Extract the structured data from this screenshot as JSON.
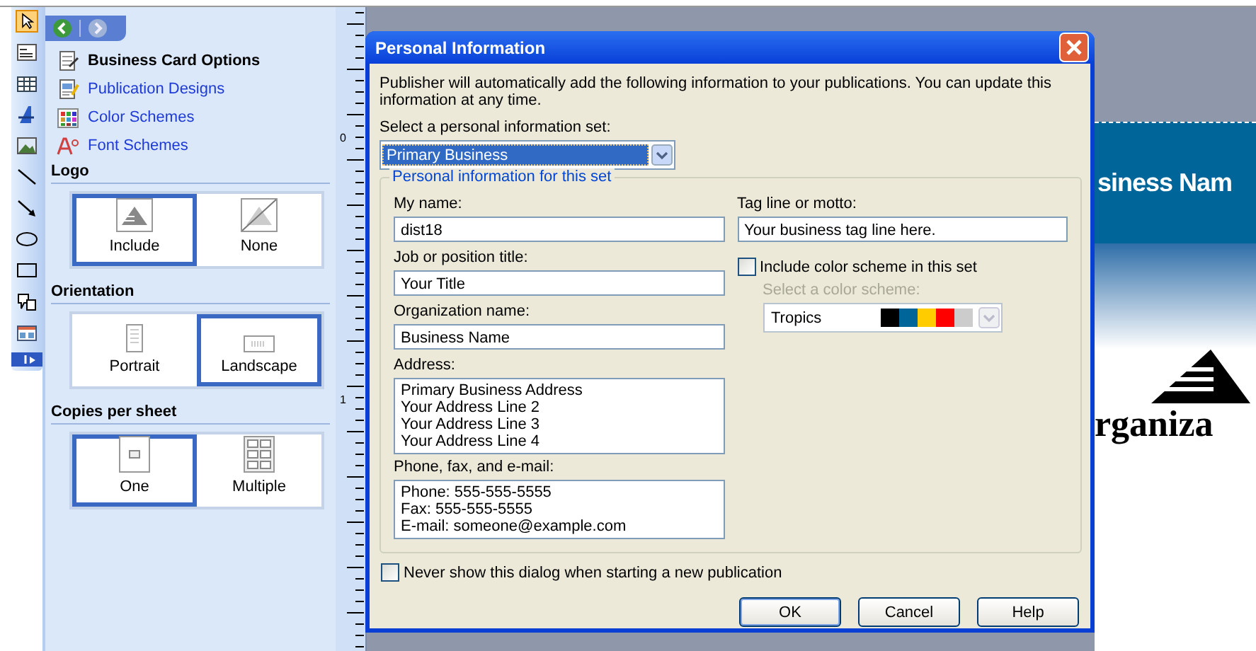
{
  "task_pane": {
    "nav": [
      {
        "label": "Business Card Options",
        "kind": "options",
        "selected": true
      },
      {
        "label": "Publication Designs",
        "kind": "designs",
        "selected": false
      },
      {
        "label": "Color Schemes",
        "kind": "colors",
        "selected": false
      },
      {
        "label": "Font Schemes",
        "kind": "fonts",
        "selected": false
      }
    ],
    "sections": [
      {
        "title": "Logo",
        "options": [
          {
            "label": "Include",
            "kind": "logo",
            "selected": true
          },
          {
            "label": "None",
            "kind": "nologo",
            "selected": false
          }
        ]
      },
      {
        "title": "Orientation",
        "options": [
          {
            "label": "Portrait",
            "kind": "portrait",
            "selected": false
          },
          {
            "label": "Landscape",
            "kind": "landscape",
            "selected": true
          }
        ]
      },
      {
        "title": "Copies per sheet",
        "options": [
          {
            "label": "One",
            "kind": "one",
            "selected": true
          },
          {
            "label": "Multiple",
            "kind": "multiple",
            "selected": false
          }
        ]
      }
    ]
  },
  "ruler": {
    "labels": [
      "0",
      "1"
    ]
  },
  "card": {
    "business_name": "siness Nam",
    "organization": "rganiza"
  },
  "dialog": {
    "title": "Personal Information",
    "intro": "Publisher will automatically add the following information to your publications.  You can update this information at any time.",
    "set_label": "Select a personal information set:",
    "set_value": "Primary Business",
    "group_title": "Personal information for this set",
    "left_fields": [
      {
        "label": "My name:",
        "kind": "line",
        "lines": [
          "dist18"
        ]
      },
      {
        "label": "Job or position title:",
        "kind": "line",
        "lines": [
          "Your Title"
        ]
      },
      {
        "label": "Organization name:",
        "kind": "line",
        "lines": [
          "Business Name"
        ]
      },
      {
        "label": "Address:",
        "kind": "multiline",
        "lines": [
          "Primary Business Address",
          "Your Address Line 2",
          "Your Address Line 3",
          "Your Address Line 4"
        ]
      },
      {
        "label": "Phone, fax, and e-mail:",
        "kind": "multiline",
        "lines": [
          "Phone: 555-555-5555",
          "Fax: 555-555-5555",
          "E-mail: someone@example.com"
        ]
      }
    ],
    "tagline": {
      "label": "Tag line or motto:",
      "value": "Your business tag line here."
    },
    "color_checkbox": {
      "label": "Include color scheme in this set",
      "checked": false
    },
    "scheme": {
      "label": "Select a color scheme:",
      "value": "Tropics",
      "disabled": true,
      "swatches": [
        {
          "color": "#000000"
        },
        {
          "color": "#006699"
        },
        {
          "color": "#ffcc00"
        },
        {
          "color": "#ff0000"
        },
        {
          "color": "#cccccc"
        }
      ]
    },
    "never_show": {
      "label": "Never show this dialog when starting a new publication",
      "checked": false
    },
    "buttons": [
      {
        "label": "OK",
        "default": true
      },
      {
        "label": "Cancel",
        "default": false
      },
      {
        "label": "Help",
        "default": false
      }
    ]
  }
}
